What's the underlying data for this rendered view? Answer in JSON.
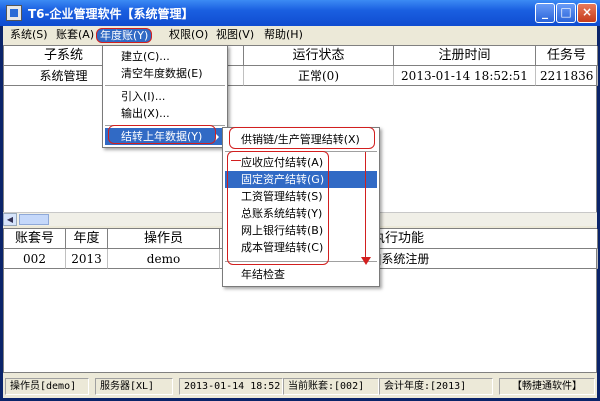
{
  "window": {
    "title": "T6-企业管理软件【系统管理】",
    "buttons": {
      "minimize": "_",
      "maximize": "□",
      "close": "×"
    }
  },
  "menubar": [
    "系统(S)",
    "账套(A)",
    "年度账(Y)",
    "权限(O)",
    "视图(V)",
    "帮助(H)"
  ],
  "top_table": {
    "headers": [
      "子系统",
      "运行状态",
      "注册时间",
      "任务号"
    ],
    "rows": [
      [
        "系统管理",
        "正常(0)",
        "2013-01-14 18:52:51",
        "2211836"
      ]
    ]
  },
  "bottom_table": {
    "headers": [
      "账套号",
      "年度",
      "操作员",
      "执行功能"
    ],
    "rows": [
      [
        "002",
        "2013",
        "demo",
        "[]系统注册"
      ]
    ]
  },
  "year_menu": {
    "items": [
      "建立(C)...",
      "清空年度数据(E)",
      "引入(I)...",
      "输出(X)...",
      "结转上年数据(Y)"
    ]
  },
  "carry_menu": {
    "items": [
      "供销链/生产管理结转(X)",
      "应收应付结转(A)",
      "固定资产结转(G)",
      "工资管理结转(S)",
      "总账系统结转(Y)",
      "网上银行结转(B)",
      "成本管理结转(C)",
      "年结检查"
    ]
  },
  "statusbar": {
    "operator": "操作员[demo]",
    "server": "服务器[XL]",
    "datetime": "2013-01-14 18:52",
    "account": "当前账套:[002]",
    "year": "会计年度:[2013]",
    "brand": "【畅捷通软件】"
  },
  "colors": {
    "highlight": "#316ac5",
    "annotation": "#d21f1f",
    "titlebar": "#1a5fe0"
  },
  "icons": [
    "app-icon",
    "minimize-icon",
    "maximize-icon",
    "close-icon",
    "submenu-arrow-icon",
    "scroll-left-icon"
  ]
}
